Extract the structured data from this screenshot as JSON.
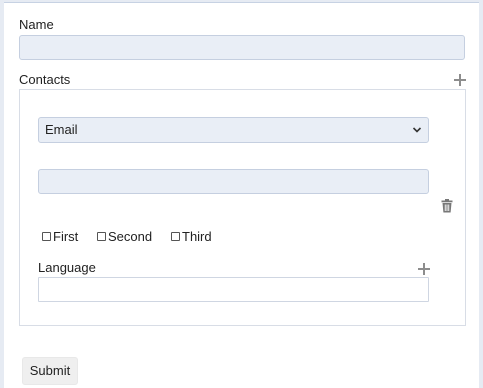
{
  "form": {
    "name_label": "Name",
    "name_value": "",
    "contacts_label": "Contacts",
    "contact": {
      "type_selected": "Email",
      "value": "",
      "checkboxes": [
        {
          "label": "First",
          "checked": false
        },
        {
          "label": "Second",
          "checked": false
        },
        {
          "label": "Third",
          "checked": false
        }
      ],
      "language_label": "Language",
      "language_value": ""
    },
    "submit_label": "Submit"
  },
  "icons": {
    "add_contact": "plus-icon",
    "add_language": "plus-icon",
    "delete_contact": "trash-icon",
    "select_arrow": "chevron-down-icon"
  },
  "colors": {
    "page_bg": "#e6ebf3",
    "input_bg": "#e9eef6",
    "border": "#c5cfe0",
    "icon": "#8d8d8d"
  }
}
